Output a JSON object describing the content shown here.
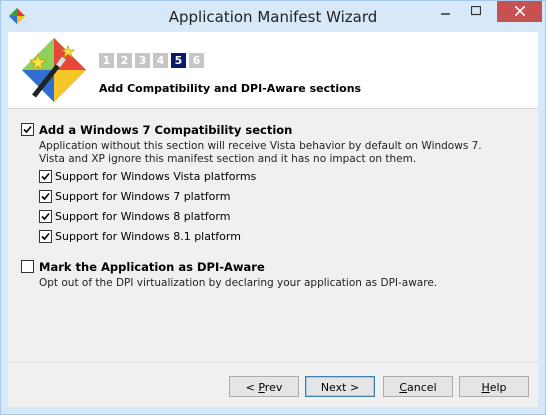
{
  "window": {
    "title": "Application Manifest Wizard"
  },
  "header": {
    "steps": [
      "1",
      "2",
      "3",
      "4",
      "5",
      "6"
    ],
    "active_step": "5",
    "title": "Add Compatibility and DPI-Aware sections"
  },
  "compat": {
    "label": "Add a Windows 7 Compatibility section",
    "checked": true,
    "description_line1": "Application without this section will receive Vista behavior by default on Windows 7.",
    "description_line2": "Vista and XP ignore this manifest section and it has no impact on them.",
    "options": [
      {
        "label": "Support for Windows Vista platforms",
        "checked": true
      },
      {
        "label": "Support for Windows 7 platform",
        "checked": true
      },
      {
        "label": "Support for Windows 8 platform",
        "checked": true
      },
      {
        "label": "Support for Windows 8.1 platform",
        "checked": true
      }
    ]
  },
  "dpi": {
    "label": "Mark the Application as DPI-Aware",
    "checked": false,
    "description": "Opt out of the DPI virtualization by declaring your application as DPI-aware."
  },
  "buttons": {
    "prev_prefix": "< ",
    "prev_key": "P",
    "prev_rest": "rev",
    "next": "Next >",
    "cancel_key": "C",
    "cancel_rest": "ancel",
    "help_key": "H",
    "help_rest": "elp"
  },
  "colors": {
    "titlebar": "#d7e8f8",
    "close_button": "#c75050",
    "active_step": "#0a1a6b",
    "inactive_step": "#c6c6c6"
  }
}
